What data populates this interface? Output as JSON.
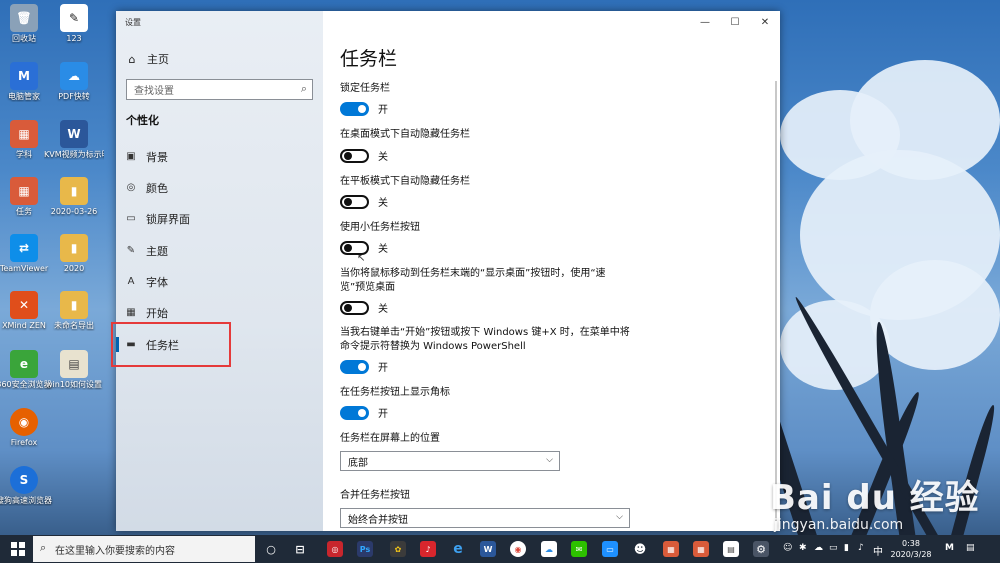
{
  "desktop": {
    "icons": [
      {
        "label": "回收站",
        "glyph": "🗑",
        "color": "#8aa1b8"
      },
      {
        "label": "123",
        "glyph": "✎",
        "color": "#ffffff"
      },
      {
        "label": "电脑管家",
        "glyph": "M",
        "color": "#2a6fd6"
      },
      {
        "label": "PDF快转",
        "glyph": "☁",
        "color": "#2a8ce6"
      },
      {
        "label": "学科",
        "glyph": "▦",
        "color": "#d95b3a"
      },
      {
        "label": "KVM视频为标示明",
        "glyph": "W",
        "color": "#2b579a"
      },
      {
        "label": "任务",
        "glyph": "▦",
        "color": "#d95b3a"
      },
      {
        "label": "2020-03-26",
        "glyph": "▮",
        "color": "#e8b84a"
      },
      {
        "label": "TeamViewer",
        "glyph": "⇄",
        "color": "#0e8ee9"
      },
      {
        "label": "2020",
        "glyph": "▮",
        "color": "#e8b84a"
      },
      {
        "label": "XMind ZEN",
        "glyph": "✕",
        "color": "#e04e1b"
      },
      {
        "label": "未命名导出",
        "glyph": "▮",
        "color": "#e8b84a"
      },
      {
        "label": "360安全浏览器",
        "glyph": "e",
        "color": "#3aa53a"
      },
      {
        "label": "win10如何设置",
        "glyph": "▤",
        "color": "#e8e2cf"
      },
      {
        "label": "Firefox",
        "glyph": "◉",
        "color": "#e66000"
      },
      {
        "label": "搜狗高速浏览器",
        "glyph": "S",
        "color": "#1c6fd8"
      }
    ]
  },
  "window": {
    "title": "设置",
    "controls": {
      "minimize": "—",
      "maximize": "☐",
      "close": "✕"
    }
  },
  "sidebar": {
    "home_label": "主页",
    "search_placeholder": "查找设置",
    "section_title": "个性化",
    "items": [
      {
        "label": "背景",
        "icon": "🖼"
      },
      {
        "label": "颜色",
        "icon": "◎"
      },
      {
        "label": "锁屏界面",
        "icon": "▭"
      },
      {
        "label": "主题",
        "icon": "✎"
      },
      {
        "label": "字体",
        "icon": "A"
      },
      {
        "label": "开始",
        "icon": "▦"
      },
      {
        "label": "任务栏",
        "icon": "▬"
      }
    ]
  },
  "content": {
    "title": "任务栏",
    "settings": [
      {
        "label": "锁定任务栏",
        "state": "开",
        "on": true
      },
      {
        "label": "在桌面模式下自动隐藏任务栏",
        "state": "关",
        "on": false
      },
      {
        "label": "在平板模式下自动隐藏任务栏",
        "state": "关",
        "on": false
      },
      {
        "label": "使用小任务栏按钮",
        "state": "关",
        "on": false
      },
      {
        "label": "当你将鼠标移动到任务栏末端的“显示桌面”按钮时，使用“速览”预览桌面",
        "state": "关",
        "on": false
      },
      {
        "label": "当我右键单击“开始”按钮或按下 Windows 键+X 时，在菜单中将命令提示符替换为 Windows PowerShell",
        "state": "开",
        "on": true
      },
      {
        "label": "在任务栏按钮上显示角标",
        "state": "开",
        "on": true
      }
    ],
    "position_label": "任务栏在屏幕上的位置",
    "position_value": "底部",
    "combine_label": "合并任务栏按钮",
    "combine_value": "始终合并按钮"
  },
  "taskbar": {
    "search_placeholder": "在这里输入你要搜索的内容",
    "ime": "中",
    "time": "0:38",
    "date": "2020/3/28"
  },
  "watermark": {
    "big": "Bai du 经验",
    "small": "jingyan.baidu.com"
  },
  "colors": {
    "accent": "#0078d7",
    "highlight": "#e53a3a"
  }
}
